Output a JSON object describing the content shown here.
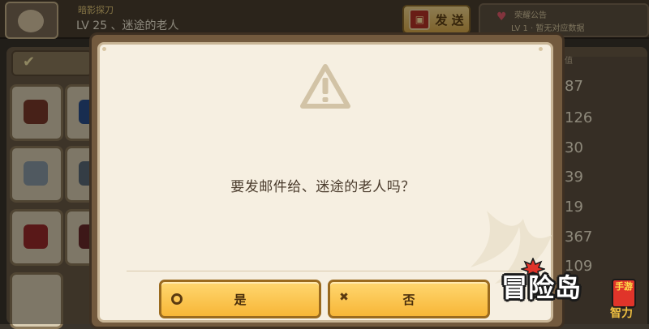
{
  "header": {
    "player_subtitle": "暗影探刀",
    "player_line": "LV 25 、迷途的老人",
    "send_label": "发 送",
    "notice_title": "荣耀公告",
    "notice_text": "LV 1 · 暂无对应数据"
  },
  "right_column": {
    "header": "数值",
    "values": [
      "87",
      "126",
      "30",
      "39",
      "19",
      "367",
      "109"
    ]
  },
  "bottom_right_tag": "智力",
  "dialog": {
    "icon": "warning-triangle-icon",
    "message": "要发邮件给、迷途的老人吗？",
    "yes_label": "是",
    "no_label": "否",
    "yes_icon": "circle-icon",
    "no_icon": "cross-icon"
  },
  "logo": {
    "name": "冒险岛",
    "tag": "手游"
  },
  "colors": {
    "button_fill": "#f7b637",
    "dialog_bg": "#f6efe1",
    "frame": "#735a3e"
  }
}
